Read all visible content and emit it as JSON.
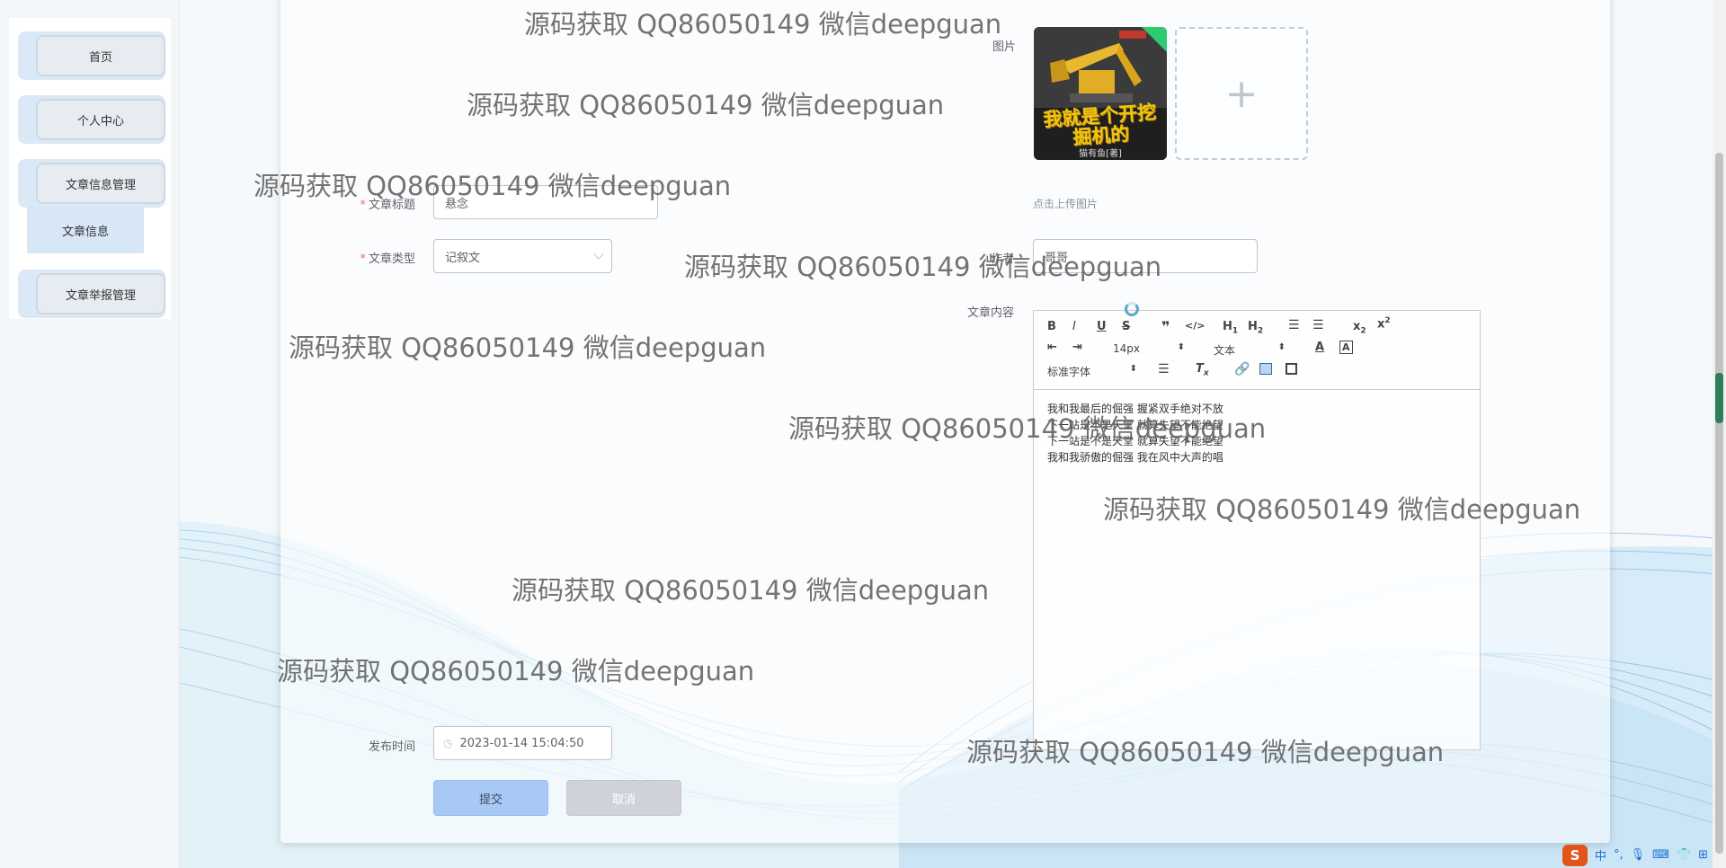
{
  "sidebar": {
    "items": [
      {
        "label": "首页"
      },
      {
        "label": "个人中心"
      },
      {
        "label": "文章信息管理"
      },
      {
        "label": "文章举报管理"
      }
    ],
    "submenu": [
      {
        "label": "文章信息"
      }
    ]
  },
  "form": {
    "title_label": "文章标题",
    "title_value": "悬念",
    "type_label": "文章类型",
    "type_value": "记叙文",
    "image_label": "图片",
    "image_cover_text": "我就是个开挖掘机的",
    "image_author_text": "猫有鱼[著]",
    "upload_hint": "点击上传图片",
    "author_label": "作者",
    "author_value": "哥哥",
    "content_label": "文章内容",
    "publish_label": "发布时间",
    "publish_value": "2023-01-14 15:04:50",
    "submit_label": "提交",
    "cancel_label": "取消"
  },
  "editor": {
    "font_size": "14px",
    "block_format": "文本",
    "font_family": "标准字体",
    "lines": [
      "我和我最后的倔强 握紧双手绝对不放",
      "下一站是不是天堂 就算失望不能绝望",
      "下一站是不是天堂 就算失望不能绝望",
      "我和我骄傲的倔强 我在风中大声的唱"
    ],
    "toolbar_icons": [
      "bold-icon",
      "italic-icon",
      "underline-icon",
      "strike-icon",
      "blockquote-icon",
      "code-block-icon",
      "h1-icon",
      "h2-icon",
      "ordered-list-icon",
      "bullet-list-icon",
      "subscript-icon",
      "superscript-icon",
      "outdent-icon",
      "indent-icon",
      "font-color-icon",
      "background-color-icon",
      "align-icon",
      "clear-format-icon",
      "link-icon",
      "image-icon",
      "video-icon"
    ]
  },
  "watermark": "源码获取 QQ86050149 微信deepguan",
  "ime": {
    "lang": "中"
  },
  "colors": {
    "accent": "#a8c8f5",
    "required": "#f56c6c",
    "scroll_thumb": "#2e7d5b"
  }
}
